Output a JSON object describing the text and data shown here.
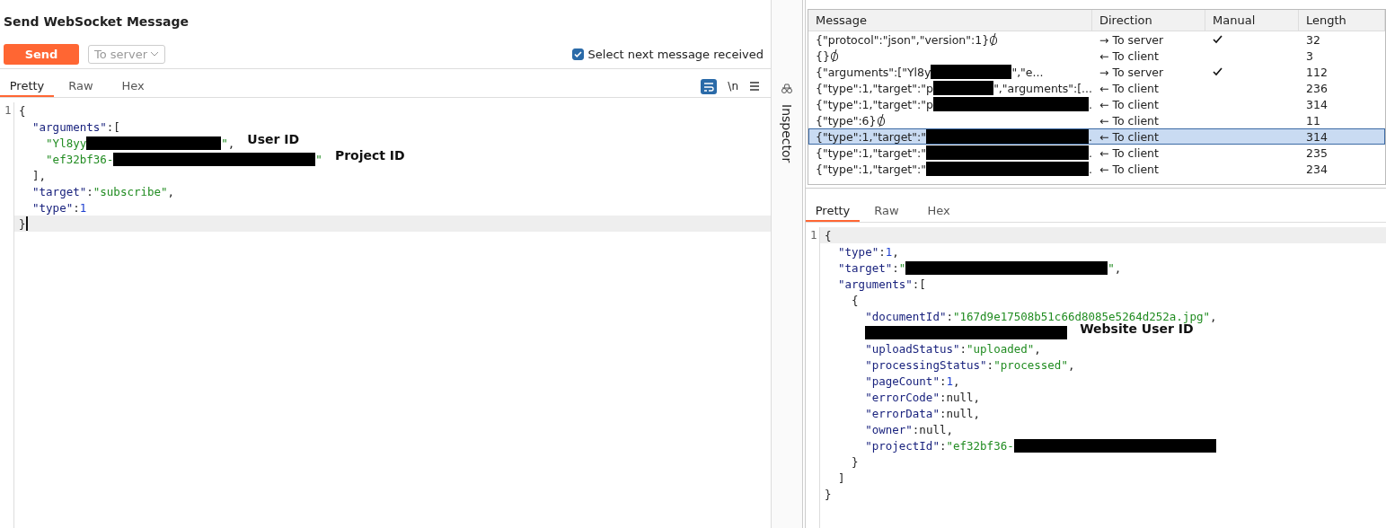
{
  "title": "Send WebSocket Message",
  "send_button": "Send",
  "direction_select": {
    "value": "To server"
  },
  "select_next": {
    "label": "Select next message received",
    "checked": true
  },
  "editor_tabs": [
    {
      "label": "Pretty",
      "selected": true
    },
    {
      "label": "Raw",
      "selected": false
    },
    {
      "label": "Hex",
      "selected": false
    }
  ],
  "editor_tools": {
    "wrap_on": true,
    "newline": "\\n"
  },
  "editor_lines": [
    {
      "number": "1",
      "tokens": [
        {
          "kind": "punc",
          "text": "{"
        }
      ],
      "children": [
        {
          "tokens": [
            {
              "kind": "key",
              "text": "\"arguments\""
            },
            {
              "kind": "punc",
              "text": ":["
            }
          ],
          "children": [
            {
              "tokens": [
                {
                  "kind": "str",
                  "text": "\"Yl8yy"
                },
                {
                  "kind": "redact"
                },
                {
                  "kind": "str",
                  "text": "\""
                },
                {
                  "kind": "punc",
                  "text": ","
                }
              ],
              "note": "User ID"
            },
            {
              "tokens": [
                {
                  "kind": "str",
                  "text": "\"ef32bf36-"
                },
                {
                  "kind": "redact",
                  "wide": true
                },
                {
                  "kind": "str",
                  "text": "\""
                }
              ],
              "note": "Project ID"
            }
          ]
        },
        {
          "tokens": [
            {
              "kind": "punc",
              "text": "],"
            }
          ]
        },
        {
          "tokens": [
            {
              "kind": "key",
              "text": "\"target\""
            },
            {
              "kind": "punc",
              "text": ":"
            },
            {
              "kind": "str",
              "text": "\"subscribe\""
            },
            {
              "kind": "punc",
              "text": ","
            }
          ]
        },
        {
          "tokens": [
            {
              "kind": "key",
              "text": "\"type\""
            },
            {
              "kind": "punc",
              "text": ":"
            },
            {
              "kind": "num",
              "text": "1"
            }
          ]
        }
      ]
    },
    {
      "current": true,
      "tokens": [
        {
          "kind": "punc",
          "text": "}"
        }
      ]
    }
  ],
  "inspector": "Inspector",
  "table": {
    "columns": [
      "Message",
      "Direction",
      "Manual",
      "Length"
    ],
    "rows": [
      {
        "message": [
          {
            "kind": "text",
            "text": "{\"protocol\":\"json\",\"version\":1}"
          },
          {
            "kind": "marker"
          }
        ],
        "direction": "→ To server",
        "manual": true,
        "length": "32",
        "selected": false
      },
      {
        "message": [
          {
            "kind": "text",
            "text": "{}"
          },
          {
            "kind": "marker"
          }
        ],
        "direction": "← To client",
        "manual": false,
        "length": "3",
        "selected": false
      },
      {
        "message": [
          {
            "kind": "text",
            "text": "{\"arguments\":[\"Yl8y"
          },
          {
            "kind": "redact"
          },
          {
            "kind": "text",
            "text": "\",\"e..."
          }
        ],
        "direction": "→ To server",
        "manual": true,
        "length": "112",
        "selected": false
      },
      {
        "message": [
          {
            "kind": "text",
            "text": "{\"type\":1,\"target\":\"p"
          },
          {
            "kind": "redact"
          },
          {
            "kind": "text",
            "text": "\",\"arguments\":[..."
          }
        ],
        "direction": "← To client",
        "manual": false,
        "length": "236",
        "selected": false
      },
      {
        "message": [
          {
            "kind": "text",
            "text": "{\"type\":1,\"target\":\"p"
          },
          {
            "kind": "redact",
            "wide": true
          },
          {
            "kind": "text",
            "text": "."
          }
        ],
        "direction": "← To client",
        "manual": false,
        "length": "314",
        "selected": false
      },
      {
        "message": [
          {
            "kind": "text",
            "text": "{\"type\":6}"
          },
          {
            "kind": "marker"
          }
        ],
        "direction": "← To client",
        "manual": false,
        "length": "11",
        "selected": false
      },
      {
        "message": [
          {
            "kind": "text",
            "text": "{\"type\":1,\"target\":\""
          },
          {
            "kind": "redact",
            "wide": true
          },
          {
            "kind": "text",
            "text": "."
          }
        ],
        "direction": "← To client",
        "manual": false,
        "length": "314",
        "selected": true
      },
      {
        "message": [
          {
            "kind": "text",
            "text": "{\"type\":1,\"target\":\""
          },
          {
            "kind": "redact",
            "wide": true
          },
          {
            "kind": "text",
            "text": "."
          }
        ],
        "direction": "← To client",
        "manual": false,
        "length": "235",
        "selected": false
      },
      {
        "message": [
          {
            "kind": "text",
            "text": "{\"type\":1,\"target\":\""
          },
          {
            "kind": "redact",
            "wide": true
          },
          {
            "kind": "text",
            "text": "."
          }
        ],
        "direction": "← To client",
        "manual": false,
        "length": "234",
        "selected": false
      }
    ]
  },
  "viewer_tabs": [
    {
      "label": "Pretty",
      "selected": true
    },
    {
      "label": "Raw",
      "selected": false
    },
    {
      "label": "Hex",
      "selected": false
    }
  ],
  "viewer_lines": [
    {
      "number": "1",
      "current": true,
      "tokens": [
        {
          "kind": "punc",
          "text": "{"
        }
      ],
      "children": [
        {
          "tokens": [
            {
              "kind": "key",
              "text": "\"type\""
            },
            {
              "kind": "punc",
              "text": ":"
            },
            {
              "kind": "num",
              "text": "1"
            },
            {
              "kind": "punc",
              "text": ","
            }
          ]
        },
        {
          "tokens": [
            {
              "kind": "key",
              "text": "\"target\""
            },
            {
              "kind": "punc",
              "text": ":"
            },
            {
              "kind": "str",
              "text": "\""
            },
            {
              "kind": "redact",
              "wide": true
            },
            {
              "kind": "str",
              "text": "\""
            },
            {
              "kind": "punc",
              "text": ","
            }
          ]
        },
        {
          "tokens": [
            {
              "kind": "key",
              "text": "\"arguments\""
            },
            {
              "kind": "punc",
              "text": ":["
            }
          ],
          "children": [
            {
              "tokens": [
                {
                  "kind": "punc",
                  "text": "{"
                }
              ],
              "children": [
                {
                  "tokens": [
                    {
                      "kind": "key",
                      "text": "\"documentId\""
                    },
                    {
                      "kind": "punc",
                      "text": ":"
                    },
                    {
                      "kind": "str",
                      "text": "\"167d9e17508b51c66d8085e5264d252a.jpg\""
                    },
                    {
                      "kind": "punc",
                      "text": ","
                    }
                  ]
                },
                {
                  "tokens": [
                    {
                      "kind": "redact",
                      "wide": true
                    }
                  ],
                  "note": "Website User ID"
                },
                {
                  "tokens": [
                    {
                      "kind": "key",
                      "text": "\"uploadStatus\""
                    },
                    {
                      "kind": "punc",
                      "text": ":"
                    },
                    {
                      "kind": "str",
                      "text": "\"uploaded\""
                    },
                    {
                      "kind": "punc",
                      "text": ","
                    }
                  ]
                },
                {
                  "tokens": [
                    {
                      "kind": "key",
                      "text": "\"processingStatus\""
                    },
                    {
                      "kind": "punc",
                      "text": ":"
                    },
                    {
                      "kind": "str",
                      "text": "\"processed\""
                    },
                    {
                      "kind": "punc",
                      "text": ","
                    }
                  ]
                },
                {
                  "tokens": [
                    {
                      "kind": "key",
                      "text": "\"pageCount\""
                    },
                    {
                      "kind": "punc",
                      "text": ":"
                    },
                    {
                      "kind": "num",
                      "text": "1"
                    },
                    {
                      "kind": "punc",
                      "text": ","
                    }
                  ]
                },
                {
                  "tokens": [
                    {
                      "kind": "key",
                      "text": "\"errorCode\""
                    },
                    {
                      "kind": "punc",
                      "text": ":null,"
                    }
                  ]
                },
                {
                  "tokens": [
                    {
                      "kind": "key",
                      "text": "\"errorData\""
                    },
                    {
                      "kind": "punc",
                      "text": ":null,"
                    }
                  ]
                },
                {
                  "tokens": [
                    {
                      "kind": "key",
                      "text": "\"owner\""
                    },
                    {
                      "kind": "punc",
                      "text": ":null,"
                    }
                  ]
                },
                {
                  "tokens": [
                    {
                      "kind": "key",
                      "text": "\"projectId\""
                    },
                    {
                      "kind": "punc",
                      "text": ":"
                    },
                    {
                      "kind": "str",
                      "text": "\"ef32bf36-"
                    },
                    {
                      "kind": "redact",
                      "wide": true
                    }
                  ]
                }
              ]
            },
            {
              "tokens": [
                {
                  "kind": "punc",
                  "text": "}"
                }
              ]
            }
          ]
        },
        {
          "tokens": [
            {
              "kind": "punc",
              "text": "]"
            }
          ]
        }
      ]
    },
    {
      "tokens": [
        {
          "kind": "punc",
          "text": "}"
        }
      ]
    }
  ]
}
